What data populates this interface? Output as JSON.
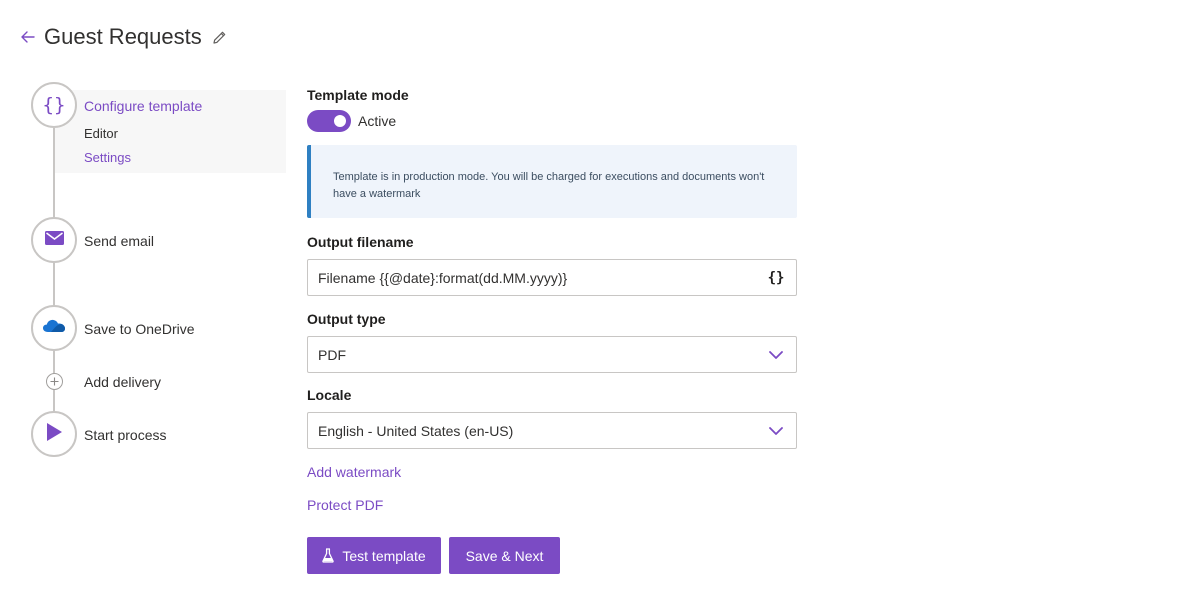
{
  "header": {
    "title": "Guest Requests",
    "back_icon": "arrow-left-icon",
    "edit_icon": "pencil-icon"
  },
  "stepper": {
    "steps": [
      {
        "label": "Configure template",
        "icon": "curly-braces-icon",
        "active": true,
        "sub_items": [
          {
            "label": "Editor"
          },
          {
            "label": "Settings"
          }
        ]
      },
      {
        "label": "Send email",
        "icon": "envelope-icon"
      },
      {
        "label": "Save to OneDrive",
        "icon": "onedrive-cloud-icon"
      },
      {
        "label": "Add delivery",
        "icon": "plus-icon"
      },
      {
        "label": "Start process",
        "icon": "play-icon"
      }
    ]
  },
  "form": {
    "template_mode": {
      "label": "Template mode",
      "toggle_label": "Active",
      "on": true
    },
    "info_message": "Template is in production mode. You will be charged for executions and documents won't have a watermark",
    "output_filename": {
      "label": "Output filename",
      "value": "Filename {{@date}:format(dd.MM.yyyy)}",
      "suffix_icon": "curly-braces-icon"
    },
    "output_type": {
      "label": "Output type",
      "value": "PDF"
    },
    "locale": {
      "label": "Locale",
      "value": "English - United States (en-US)"
    },
    "add_watermark_link": "Add watermark",
    "protect_pdf_link": "Protect PDF",
    "buttons": {
      "test_template": "Test template",
      "save_next": "Save & Next"
    }
  },
  "colors": {
    "accent": "#7b4bc4",
    "info_border": "#2f80c2",
    "info_bg": "#eff4fb"
  }
}
